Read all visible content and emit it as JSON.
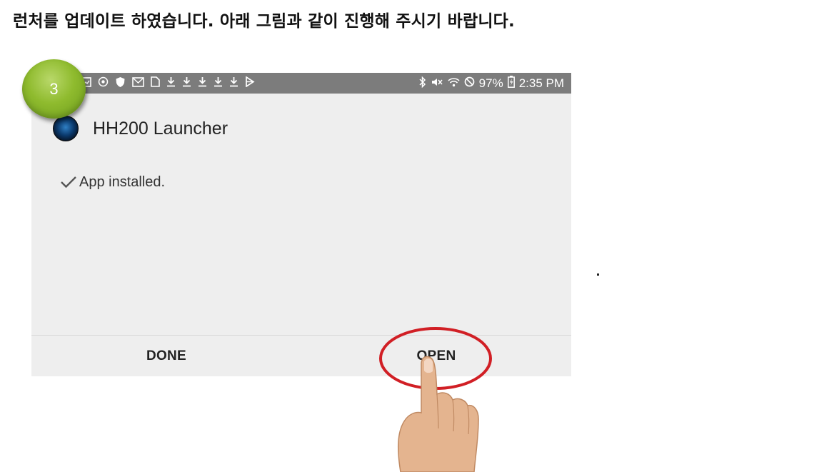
{
  "heading": "런처를 업데이트 하였습니다. 아래 그림과 같이 진행해 주시기 바랍니다.",
  "step_badge": "3",
  "status_bar": {
    "battery": "97%",
    "time": "2:35 PM"
  },
  "dialog": {
    "app_name": "HH200 Launcher",
    "status_message": "App installed.",
    "done_label": "DONE",
    "open_label": "OPEN"
  },
  "colors": {
    "status_bar": "#7c7c7c",
    "dialog_bg": "#eeeeee",
    "badge": "#8fbb2e",
    "highlight_ring": "#d11f25"
  }
}
